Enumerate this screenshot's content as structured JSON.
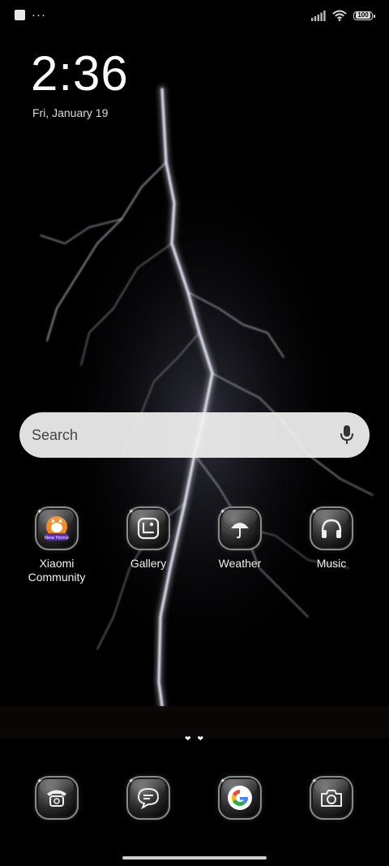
{
  "status_bar": {
    "left_icons": [
      "notification-square-icon",
      "more-notifications-icon"
    ],
    "more_glyph": "···",
    "right_icons": [
      "signal-icon",
      "wifi-icon",
      "battery-icon"
    ],
    "battery_level": "100"
  },
  "clock": {
    "time": "2:36",
    "date": "Fri, January 19"
  },
  "search": {
    "placeholder": "Search",
    "mic_icon": "microphone-icon"
  },
  "apps": [
    {
      "label_line1": "Xiaomi",
      "label_line2": "Community",
      "icon": "xiaomi-community-icon",
      "badge_text": "New Home"
    },
    {
      "label_line1": "Gallery",
      "label_line2": "",
      "icon": "gallery-icon"
    },
    {
      "label_line1": "Weather",
      "label_line2": "",
      "icon": "weather-umbrella-icon"
    },
    {
      "label_line1": "Music",
      "label_line2": "",
      "icon": "headphones-icon"
    }
  ],
  "page_indicator": {
    "pages": 2,
    "current": 1,
    "glyph": "❤"
  },
  "dock": [
    {
      "icon": "phone-icon"
    },
    {
      "icon": "messages-icon"
    },
    {
      "icon": "google-icon",
      "glyph": "G"
    },
    {
      "icon": "camera-icon"
    }
  ],
  "colors": {
    "search_bg": "#f0f0f0",
    "text": "#ffffff",
    "google_blue": "#4285F4",
    "google_red": "#EA4335",
    "google_yellow": "#FBBC05",
    "google_green": "#34A853"
  }
}
